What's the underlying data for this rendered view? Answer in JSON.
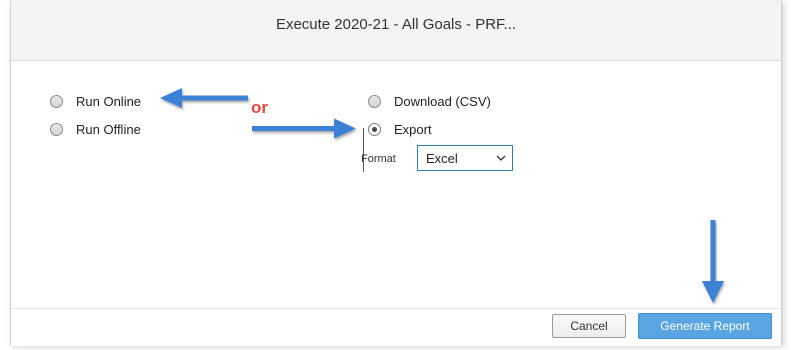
{
  "dialog": {
    "title": "Execute 2020-21 - All Goals - PRF..."
  },
  "run_options": [
    {
      "label": "Run Online",
      "selected": false
    },
    {
      "label": "Run Offline",
      "selected": false
    }
  ],
  "output_options": [
    {
      "label": "Download (CSV)",
      "selected": false
    },
    {
      "label": "Export",
      "selected": true
    }
  ],
  "annotation": {
    "or_label": "or",
    "arrow_color": "#3b82d6",
    "or_color": "#e8473b"
  },
  "format": {
    "label": "Format",
    "selected_value": "Excel"
  },
  "footer": {
    "cancel_label": "Cancel",
    "generate_label": "Generate Report"
  },
  "colors": {
    "primary_button": "#59a5e2",
    "select_border": "#2f7bc4"
  }
}
